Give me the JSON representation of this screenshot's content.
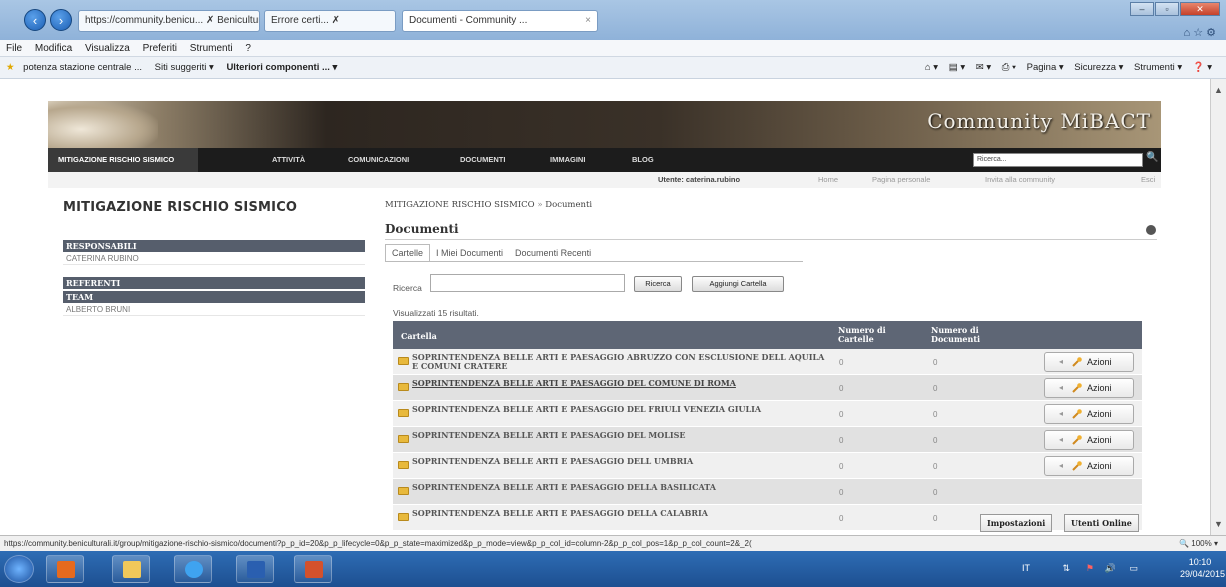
{
  "browser": {
    "tabs": [
      {
        "label": "https://community.benicu... ✗ Beniculturali..."
      },
      {
        "label": "Errore certi... ✗"
      },
      {
        "label": "Documenti - Community ..."
      }
    ],
    "tab_close": "×",
    "menu": [
      "File",
      "Modifica",
      "Visualizza",
      "Preferiti",
      "Strumenti",
      "?"
    ],
    "favorites": [
      "potenza stazione centrale ...",
      "Siti suggeriti ▾",
      "Ulteriori componenti ... ▾"
    ],
    "tools": [
      "Pagina ▾",
      "Sicurezza ▾",
      "Strumenti ▾"
    ],
    "status_url": "https://community.beniculturali.it/group/mitigazione-rischio-sismico/documenti?p_p_id=20&p_p_lifecycle=0&p_p_state=maximized&p_p_mode=view&p_p_col_id=column-2&p_p_col_pos=1&p_p_col_count=2&_2(",
    "zoom": "100%"
  },
  "site": {
    "brand": "Community MiBACT",
    "nav": [
      "MITIGAZIONE RISCHIO SISMICO",
      "ATTIVITÀ",
      "COMUNICAZIONI",
      "DOCUMENTI",
      "IMMAGINI",
      "BLOG"
    ],
    "search_placeholder": "Ricerca...",
    "user": "Utente: caterina.rubino",
    "user_links": [
      "Home",
      "Pagina personale",
      "Invita alla community",
      "Esci"
    ]
  },
  "sidebar": {
    "title": "MITIGAZIONE RISCHIO SISMICO",
    "sections": [
      {
        "head": "RESPONSABILI",
        "items": [
          "CATERINA RUBINO"
        ]
      },
      {
        "head": "REFERENTI",
        "items": []
      },
      {
        "head": "TEAM",
        "items": [
          "ALBERTO BRUNI"
        ]
      }
    ]
  },
  "main": {
    "breadcrumb": [
      "MITIGAZIONE RISCHIO SISMICO",
      "»",
      "Documenti"
    ],
    "title": "Documenti",
    "tabs": [
      "Cartelle",
      "I Miei Documenti",
      "Documenti Recenti"
    ],
    "search_label": "Ricerca",
    "search_button": "Ricerca",
    "add_button": "Aggiungi Cartella",
    "results": "Visualizzati 15 risultati.",
    "columns": [
      "Cartella",
      "Numero di Cartelle",
      "Numero di Documenti"
    ],
    "rows": [
      {
        "name": "SOPRINTENDENZA BELLE ARTI E PAESAGGIO ABRUZZO CON ESCLUSIONE DELL AQUILA E COMUNI CRATERE",
        "folders": "0",
        "docs": "0",
        "action": "Azioni"
      },
      {
        "name": "SOPRINTENDENZA BELLE ARTI E PAESAGGIO DEL COMUNE DI ROMA",
        "folders": "0",
        "docs": "0",
        "action": "Azioni"
      },
      {
        "name": "SOPRINTENDENZA BELLE ARTI E PAESAGGIO DEL FRIULI VENEZIA GIULIA",
        "folders": "0",
        "docs": "0",
        "action": "Azioni"
      },
      {
        "name": "SOPRINTENDENZA BELLE ARTI E PAESAGGIO DEL MOLISE",
        "folders": "0",
        "docs": "0",
        "action": "Azioni"
      },
      {
        "name": "SOPRINTENDENZA BELLE ARTI E PAESAGGIO DELL UMBRIA",
        "folders": "0",
        "docs": "0",
        "action": "Azioni"
      },
      {
        "name": "SOPRINTENDENZA BELLE ARTI E PAESAGGIO DELLA BASILICATA",
        "folders": "0",
        "docs": "0",
        "action": ""
      },
      {
        "name": "SOPRINTENDENZA BELLE ARTI E PAESAGGIO DELLA CALABRIA",
        "folders": "0",
        "docs": "0",
        "action": ""
      }
    ],
    "dock": [
      "Impostazioni",
      "Utenti Online"
    ]
  },
  "taskbar": {
    "lang": "IT",
    "time": "10:10",
    "date": "29/04/2015"
  },
  "colors": {
    "table_header": "#5e6675",
    "nav_bg": "#1c1c1c",
    "taskbar": "#2e6db5"
  }
}
